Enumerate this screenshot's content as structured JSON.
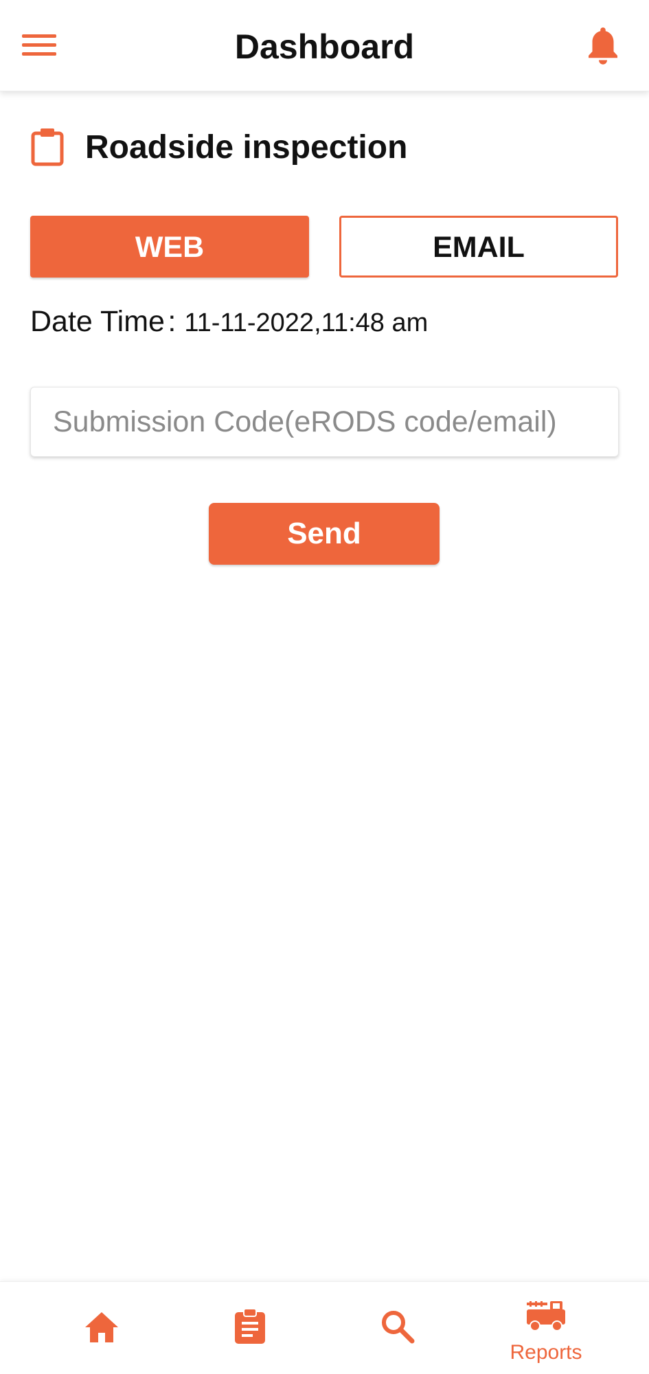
{
  "theme": {
    "accent": "#ee663c",
    "text": "#111111",
    "placeholder": "#8a8a8a"
  },
  "header": {
    "title": "Dashboard",
    "menu_icon": "hamburger-menu-icon",
    "notification_icon": "bell-icon"
  },
  "section": {
    "icon": "clipboard-icon",
    "title": "Roadside inspection"
  },
  "toggle": {
    "web_label": "WEB",
    "email_label": "EMAIL",
    "selected": "WEB"
  },
  "datetime": {
    "label": "Date Time",
    "separator": ":",
    "value": "11-11-2022,11:48 am"
  },
  "form": {
    "code_placeholder": "Submission Code(eRODS code/email)",
    "code_value": "",
    "send_label": "Send"
  },
  "bottom_nav": {
    "items": [
      {
        "icon": "home-icon",
        "label": ""
      },
      {
        "icon": "clipboard-list-icon",
        "label": ""
      },
      {
        "icon": "search-icon",
        "label": ""
      },
      {
        "icon": "fire-truck-icon",
        "label": "Reports",
        "active": true
      }
    ]
  }
}
